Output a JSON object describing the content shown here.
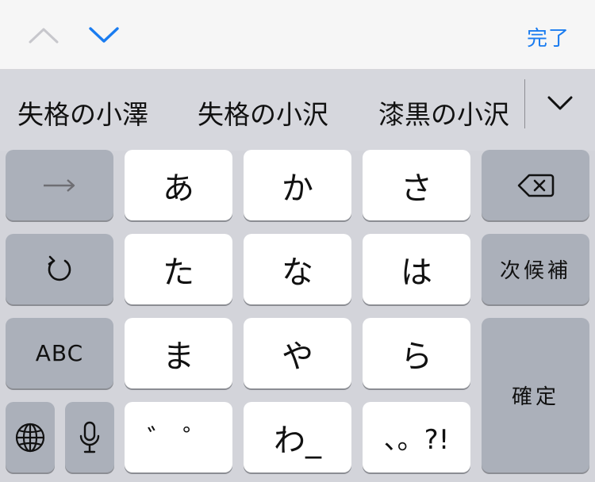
{
  "toolbar": {
    "prev_icon": "chevron-up-icon",
    "next_icon": "chevron-down-icon",
    "done_label": "完了",
    "accent_color": "#1a7cf0"
  },
  "suggestions": {
    "items": [
      "失格の小澤",
      "失格の小沢",
      "漆黒の小沢"
    ],
    "expand_icon": "chevron-down-icon"
  },
  "keyboard": {
    "row1": {
      "left_icon": "arrow-right-icon",
      "keys": [
        "あ",
        "か",
        "さ"
      ],
      "right_icon": "delete-backspace-icon"
    },
    "row2": {
      "left_icon": "undo-icon",
      "keys": [
        "た",
        "な",
        "は"
      ],
      "right_label": "次候補"
    },
    "row3": {
      "left_label": "ABC",
      "keys": [
        "ま",
        "や",
        "ら"
      ],
      "right_label": "確定"
    },
    "row4": {
      "globe_icon": "globe-icon",
      "mic_icon": "microphone-icon",
      "keys": [
        "゛ ゜",
        "わ_",
        "、。?!"
      ]
    }
  }
}
